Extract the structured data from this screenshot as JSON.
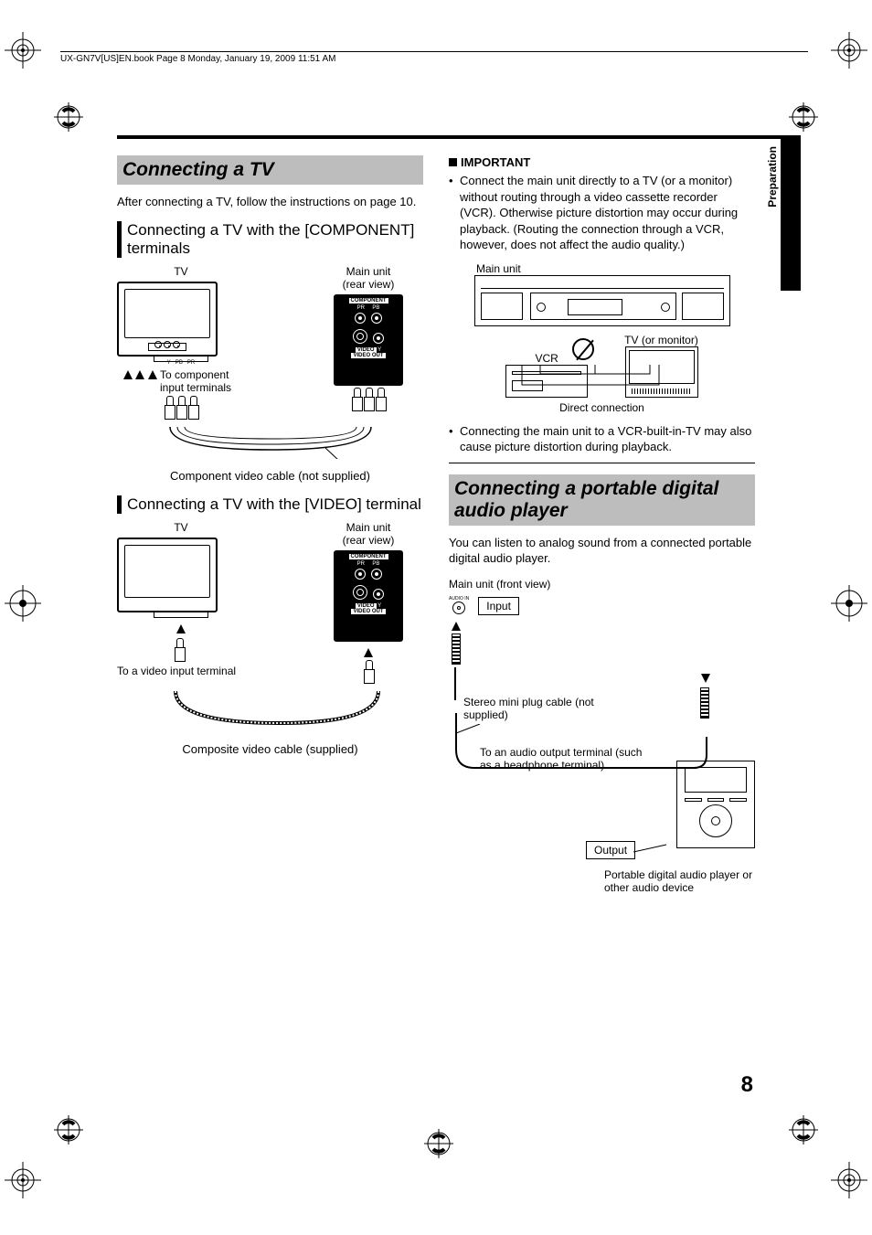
{
  "meta": {
    "book_header": "UX-GN7V[US]EN.book  Page 8  Monday, January 19, 2009  11:51 AM"
  },
  "side": {
    "section_name": "Preparation",
    "page_number": "8"
  },
  "left": {
    "h1": "Connecting a TV",
    "intro": "After connecting a TV, follow the instructions on page 10.",
    "sub1": "Connecting a TV with the [COMPONENT] terminals",
    "fig1": {
      "tv_label": "TV",
      "main_unit_label": "Main unit",
      "rear_view": "(rear view)",
      "panel_component": "COMPONENT",
      "pr": "PR",
      "pb": "PB",
      "video": "VIDEO",
      "y": "Y",
      "video_out": "VIDEO OUT",
      "to_component": "To component input terminals",
      "tv_jack_y": "Y",
      "tv_jack_pb": "PB",
      "tv_jack_pr": "PR",
      "caption": "Component video cable (not supplied)"
    },
    "sub2": "Connecting a TV with the [VIDEO] terminal",
    "fig2": {
      "tv_label": "TV",
      "main_unit_label": "Main unit",
      "rear_view": "(rear view)",
      "to_video": "To a video input terminal",
      "caption": "Composite video cable (supplied)"
    }
  },
  "right": {
    "important_hdr": "IMPORTANT",
    "bullet1": "Connect the main unit directly to a TV (or a monitor) without routing through a video cassette recorder (VCR). Otherwise picture distortion may occur during playback. (Routing the connection through a VCR, however, does not affect the audio quality.)",
    "fig_conn": {
      "main_unit": "Main unit",
      "vcr": "VCR",
      "tv_monitor": "TV (or monitor)",
      "direct": "Direct connection"
    },
    "bullet2": "Connecting the main unit to a VCR-built-in-TV may also cause picture distortion during playback.",
    "h2": "Connecting a portable digital audio player",
    "intro2": "You can listen to analog sound from a connected portable digital audio player.",
    "fig_audio": {
      "main_front": "Main unit (front view)",
      "audio_in": "AUDIO IN",
      "input": "Input",
      "stereo_cable": "Stereo mini plug cable (not supplied)",
      "to_audio_out": "To an audio output terminal (such as a headphone terminal)",
      "output": "Output",
      "player_caption": "Portable digital audio player or other audio device"
    }
  }
}
